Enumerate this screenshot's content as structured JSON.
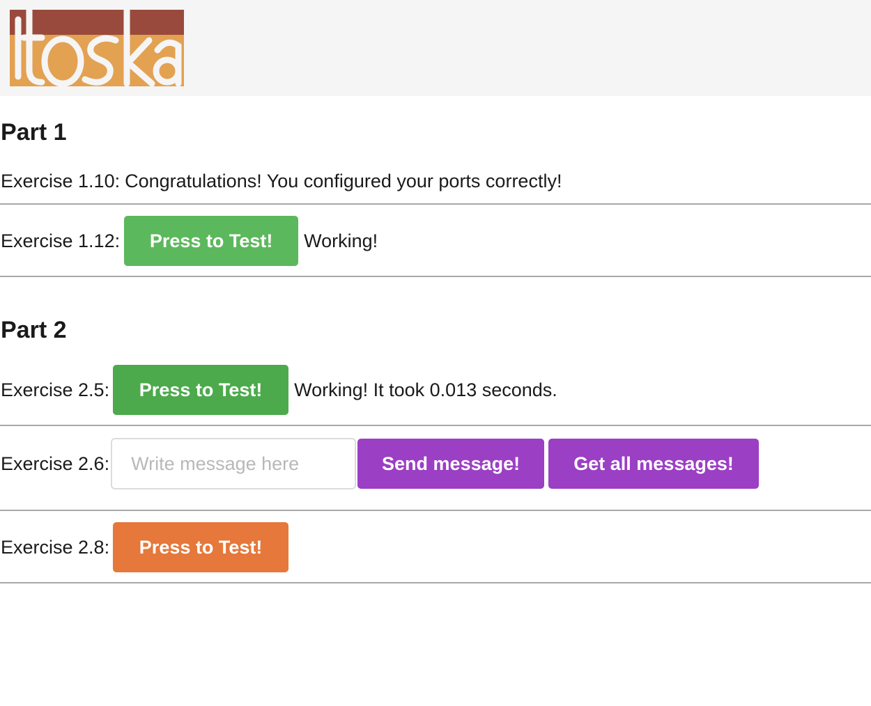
{
  "header": {
    "logo_text": "itoska",
    "colors": {
      "top": "#9a4a3c",
      "bottom": "#e3a152"
    }
  },
  "part1": {
    "title": "Part 1",
    "ex110": {
      "label": "Exercise 1.10:",
      "message": "Congratulations! You configured your ports correctly!"
    },
    "ex112": {
      "label": "Exercise 1.12:",
      "button": "Press to Test!",
      "status": "Working!"
    }
  },
  "part2": {
    "title": "Part 2",
    "ex25": {
      "label": "Exercise 2.5:",
      "button": "Press to Test!",
      "status": "Working! It took 0.013 seconds."
    },
    "ex26": {
      "label": "Exercise 2.6:",
      "input_value": "",
      "input_placeholder": "Write message here",
      "send_button": "Send message!",
      "get_button": "Get all messages!"
    },
    "ex28": {
      "label": "Exercise 2.8:",
      "button": "Press to Test!"
    }
  },
  "colors": {
    "green_button": "#5cb85c",
    "green_button_2": "#4caa4c",
    "purple_button": "#9b3fc4",
    "orange_button": "#e5783a"
  }
}
